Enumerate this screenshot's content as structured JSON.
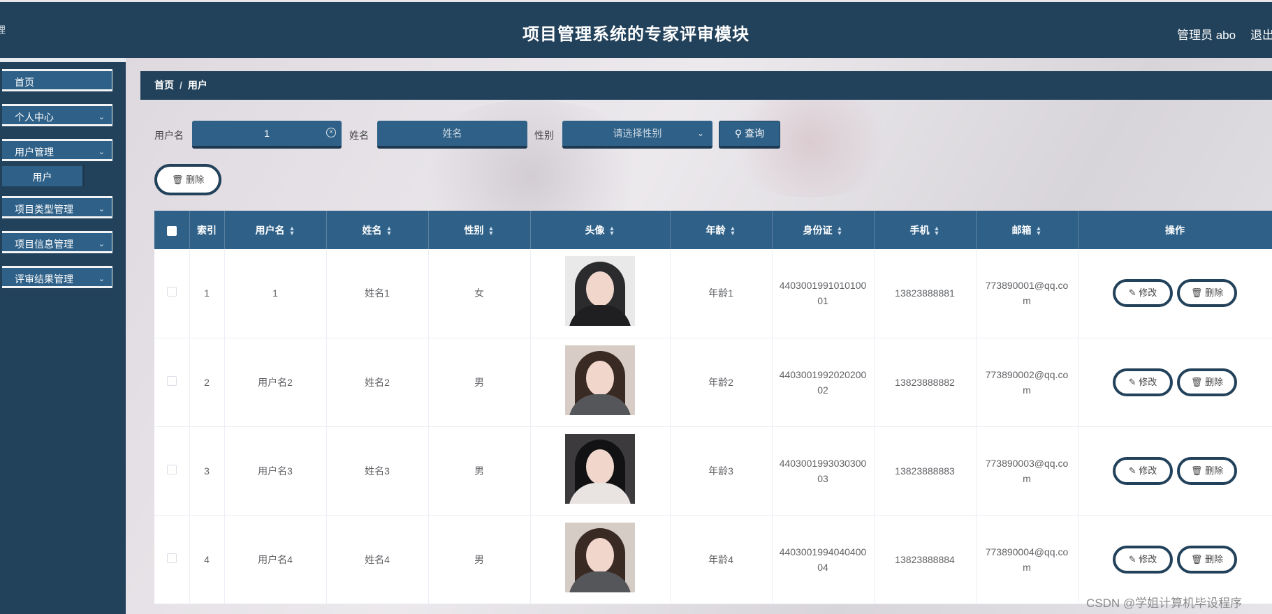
{
  "header": {
    "edge_char": "理",
    "title": "项目管理系统的专家评审模块",
    "user": "管理员 abo",
    "logout": "退出"
  },
  "sidebar": {
    "home": "首页",
    "personal": "个人中心",
    "user_mgmt": "用户管理",
    "user_sub": "用户",
    "project_type": "项目类型管理",
    "project_info": "项目信息管理",
    "review_result": "评审结果管理"
  },
  "breadcrumb": {
    "home": "首页",
    "current": "用户"
  },
  "search": {
    "username_label": "用户名",
    "username_value": "1",
    "name_label": "姓名",
    "name_placeholder": "姓名",
    "gender_label": "性别",
    "gender_placeholder": "请选择性别",
    "query": "查询"
  },
  "delete_button": "删除",
  "table": {
    "headers": [
      "索引",
      "用户名",
      "姓名",
      "性别",
      "头像",
      "年龄",
      "身份证",
      "手机",
      "邮箱",
      "操作"
    ],
    "rows": [
      {
        "index": "1",
        "username": "1",
        "name": "姓名1",
        "gender": "女",
        "age": "年龄1",
        "id_card": "440300199101010001",
        "phone": "13823888881",
        "email": "773890001@qq.com"
      },
      {
        "index": "2",
        "username": "用户名2",
        "name": "姓名2",
        "gender": "男",
        "age": "年龄2",
        "id_card": "440300199202020002",
        "phone": "13823888882",
        "email": "773890002@qq.com"
      },
      {
        "index": "3",
        "username": "用户名3",
        "name": "姓名3",
        "gender": "男",
        "age": "年龄3",
        "id_card": "440300199303030003",
        "phone": "13823888883",
        "email": "773890003@qq.com"
      },
      {
        "index": "4",
        "username": "用户名4",
        "name": "姓名4",
        "gender": "男",
        "age": "年龄4",
        "id_card": "440300199404040004",
        "phone": "13823888884",
        "email": "773890004@qq.com"
      }
    ],
    "edit": "修改",
    "delete": "删除"
  },
  "watermark": "CSDN @学姐计算机毕设程序",
  "colors": {
    "header": "#22415a",
    "accent": "#2f6188"
  },
  "icons": {
    "clear": "circle-x-icon",
    "caret": "chevron-down-icon",
    "search": "search-icon",
    "trash": "trash-icon",
    "edit": "edit-icon"
  }
}
